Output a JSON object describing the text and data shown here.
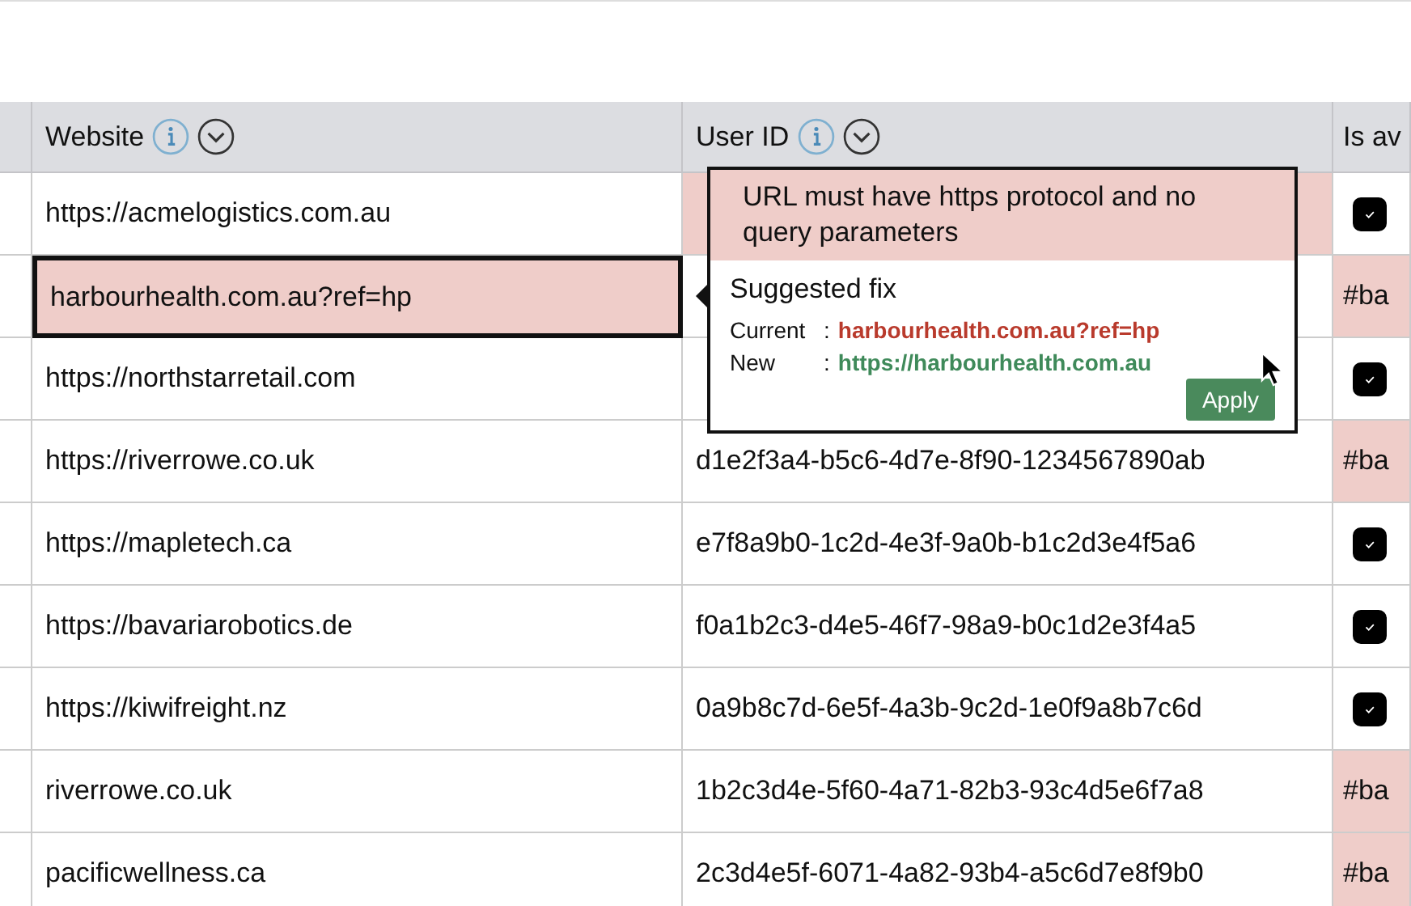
{
  "table": {
    "columns": [
      {
        "label": "Website",
        "info": true,
        "menu": true
      },
      {
        "label": "User ID",
        "info": true,
        "menu": true
      },
      {
        "label": "Is av",
        "info": false,
        "menu": false
      }
    ],
    "rows": [
      {
        "website": {
          "text": "https://acmelogistics.com.au",
          "error": false,
          "selected": false
        },
        "user_id": {
          "error": true
        },
        "flag": {
          "kind": "checkbox",
          "checked": true,
          "error": false
        }
      },
      {
        "website": {
          "text": "harbourhealth.com.au?ref=hp",
          "error": true,
          "selected": true
        },
        "user_id": {
          "error": false
        },
        "flag": {
          "kind": "text",
          "text": "#ba",
          "error": true
        }
      },
      {
        "website": {
          "text": "https://northstarretail.com",
          "error": false,
          "selected": false
        },
        "user_id": {
          "error": false
        },
        "flag": {
          "kind": "checkbox",
          "checked": true,
          "error": false
        }
      },
      {
        "website": {
          "text": "https://riverrowe.co.uk",
          "error": false,
          "selected": false
        },
        "user_id": {
          "text": "d1e2f3a4-b5c6-4d7e-8f90-1234567890ab",
          "error": false
        },
        "flag": {
          "kind": "text",
          "text": "#ba",
          "error": true
        }
      },
      {
        "website": {
          "text": "https://mapletech.ca",
          "error": false,
          "selected": false
        },
        "user_id": {
          "text": "e7f8a9b0-1c2d-4e3f-9a0b-b1c2d3e4f5a6",
          "error": false
        },
        "flag": {
          "kind": "checkbox",
          "checked": true,
          "error": false
        }
      },
      {
        "website": {
          "text": "https://bavariarobotics.de",
          "error": false,
          "selected": false
        },
        "user_id": {
          "text": "f0a1b2c3-d4e5-46f7-98a9-b0c1d2e3f4a5",
          "error": false
        },
        "flag": {
          "kind": "checkbox",
          "checked": true,
          "error": false
        }
      },
      {
        "website": {
          "text": "https://kiwifreight.nz",
          "error": false,
          "selected": false
        },
        "user_id": {
          "text": "0a9b8c7d-6e5f-4a3b-9c2d-1e0f9a8b7c6d",
          "error": false
        },
        "flag": {
          "kind": "checkbox",
          "checked": true,
          "error": false
        }
      },
      {
        "website": {
          "text": "riverrowe.co.uk",
          "error": false,
          "selected": false
        },
        "user_id": {
          "text": "1b2c3d4e-5f60-4a71-82b3-93c4d5e6f7a8",
          "error": false
        },
        "flag": {
          "kind": "text",
          "text": "#ba",
          "error": true
        }
      },
      {
        "website": {
          "text": "pacificwellness.ca",
          "error": false,
          "selected": false
        },
        "user_id": {
          "text": "2c3d4e5f-6071-4a82-93b4-a5c6d7e8f9b0",
          "error": false
        },
        "flag": {
          "kind": "text",
          "text": "#ba",
          "error": true
        }
      }
    ]
  },
  "popup": {
    "message": "URL must have https protocol and no query parameters",
    "title": "Suggested fix",
    "current_label": "Current",
    "separator": ":",
    "current_value": "harbourhealth.com.au?ref=hp",
    "new_label": "New",
    "new_value": "https://harbourhealth.com.au",
    "button": "Apply"
  }
}
